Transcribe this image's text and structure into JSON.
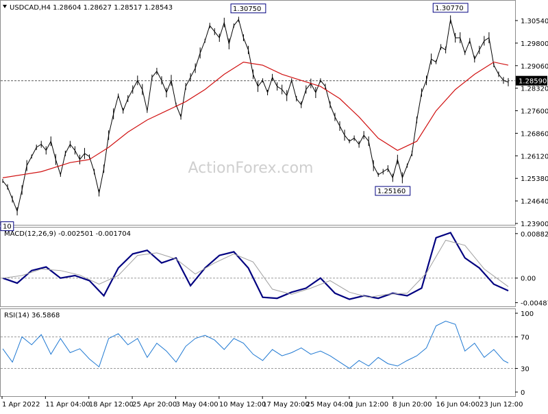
{
  "chart_data": {
    "type": "line",
    "symbol": "USDCAD",
    "timeframe": "H4",
    "title": "USDCAD,H4  1.28604  1.28627  1.28517  1.28543",
    "watermark": "ActionForex.com",
    "colors": {
      "price": "#000000",
      "ma": "#d01010",
      "macd": "#000080",
      "signal": "#a0a0a0",
      "rsi": "#1e78d2",
      "grid": "#9a9a9a",
      "tag_border": "#000080",
      "current_tag_bg": "#000000"
    },
    "panels": [
      {
        "name": "price",
        "ylim": [
          1.239,
          1.3097
        ],
        "yticks": [
          "1.30540",
          "1.29800",
          "1.29060",
          "1.28320",
          "1.27600",
          "1.26860",
          "1.26120",
          "1.25380",
          "1.24640",
          "1.23900"
        ],
        "current_price": "1.28590",
        "current_value": 1.2859,
        "labels": [
          {
            "text": "1.30750",
            "x": 51,
            "y": 1.3075
          },
          {
            "text": "1.30770",
            "x": 93,
            "y": 1.3077
          },
          {
            "text": "1.25160",
            "x": 81,
            "y": 1.2516
          },
          {
            "text": "10",
            "x": 0,
            "y": 1.24
          }
        ],
        "series": [
          {
            "role": "price",
            "x": [
              0,
              1,
              2,
              3,
              4,
              5,
              6,
              7,
              8,
              9,
              10,
              11,
              12,
              13,
              14,
              15,
              16,
              17,
              18,
              19,
              20,
              21,
              22,
              23,
              24,
              25,
              26,
              27,
              28,
              29,
              30,
              31,
              32,
              33,
              34,
              35,
              36,
              37,
              38,
              39,
              40,
              41,
              42,
              43,
              44,
              45,
              46,
              47,
              48,
              49,
              50,
              51,
              52,
              53,
              54,
              55,
              56,
              57,
              58,
              59,
              60,
              61,
              62,
              63,
              64,
              65,
              66,
              67,
              68,
              69,
              70,
              71,
              72,
              73,
              74,
              75,
              76,
              77,
              78,
              79,
              80,
              81,
              82,
              83,
              84,
              85,
              86,
              87,
              88,
              89,
              90,
              91,
              92,
              93,
              94,
              95,
              96,
              97,
              98,
              99,
              100,
              101,
              102,
              103,
              104,
              105
            ],
            "values": [
              1.253,
              1.251,
              1.247,
              1.243,
              1.25,
              1.258,
              1.261,
              1.264,
              1.265,
              1.263,
              1.266,
              1.26,
              1.255,
              1.262,
              1.265,
              1.263,
              1.26,
              1.262,
              1.261,
              1.256,
              1.249,
              1.257,
              1.268,
              1.275,
              1.281,
              1.276,
              1.28,
              1.283,
              1.286,
              1.283,
              1.276,
              1.287,
              1.289,
              1.286,
              1.282,
              1.286,
              1.278,
              1.274,
              1.284,
              1.287,
              1.29,
              1.295,
              1.299,
              1.304,
              1.302,
              1.3,
              1.305,
              1.298,
              1.304,
              1.306,
              1.3,
              1.296,
              1.288,
              1.284,
              1.286,
              1.282,
              1.287,
              1.284,
              1.283,
              1.281,
              1.286,
              1.28,
              1.278,
              1.283,
              1.285,
              1.282,
              1.286,
              1.284,
              1.278,
              1.274,
              1.271,
              1.268,
              1.266,
              1.267,
              1.265,
              1.268,
              1.266,
              1.258,
              1.255,
              1.256,
              1.257,
              1.254,
              1.26,
              1.254,
              1.258,
              1.262,
              1.273,
              1.282,
              1.286,
              1.293,
              1.292,
              1.297,
              1.296,
              1.306,
              1.3,
              1.3,
              1.295,
              1.299,
              1.293,
              1.296,
              1.299,
              1.3,
              1.291,
              1.288,
              1.286,
              1.2854
            ]
          },
          {
            "role": "moving-average",
            "x": [
              0,
              8,
              14,
              18,
              22,
              26,
              30,
              34,
              38,
              42,
              46,
              50,
              54,
              58,
              62,
              66,
              70,
              74,
              78,
              82,
              86,
              90,
              94,
              98,
              102,
              105
            ],
            "values": [
              1.254,
              1.256,
              1.259,
              1.26,
              1.264,
              1.269,
              1.273,
              1.276,
              1.279,
              1.283,
              1.288,
              1.292,
              1.291,
              1.288,
              1.286,
              1.284,
              1.28,
              1.274,
              1.267,
              1.263,
              1.266,
              1.276,
              1.283,
              1.288,
              1.292,
              1.291
            ]
          }
        ]
      },
      {
        "name": "macd",
        "title": "MACD(12,26,9) -0.002501 -0.001704",
        "ylim": [
          -0.0052,
          0.0092
        ],
        "yticks": [
          "0.00882",
          "0.00",
          "-0.004872"
        ],
        "zero_label": "0.00",
        "series": [
          {
            "role": "macd",
            "x": [
              0,
              3,
              6,
              9,
              12,
              15,
              18,
              21,
              24,
              27,
              30,
              33,
              36,
              39,
              42,
              45,
              48,
              51,
              54,
              57,
              60,
              63,
              66,
              69,
              72,
              75,
              78,
              81,
              84,
              87,
              90,
              93,
              96,
              99,
              102,
              105
            ],
            "values": [
              0.0,
              -0.001,
              0.0015,
              0.0022,
              0.0,
              0.0005,
              -0.0005,
              -0.0035,
              0.002,
              0.0048,
              0.0055,
              0.003,
              0.004,
              -0.0015,
              0.002,
              0.0045,
              0.0052,
              0.002,
              -0.0038,
              -0.004,
              -0.0028,
              -0.002,
              0.0,
              -0.003,
              -0.0042,
              -0.0035,
              -0.004,
              -0.003,
              -0.0035,
              -0.002,
              0.008,
              0.009,
              0.004,
              0.002,
              -0.0012,
              -0.0025
            ]
          },
          {
            "role": "signal",
            "x": [
              0,
              4,
              8,
              12,
              16,
              20,
              24,
              28,
              32,
              36,
              40,
              44,
              48,
              52,
              56,
              60,
              64,
              68,
              72,
              76,
              80,
              84,
              88,
              92,
              96,
              100,
              105
            ],
            "values": [
              0.0,
              0.0005,
              0.0018,
              0.0015,
              0.0006,
              -0.0012,
              0.0005,
              0.0045,
              0.005,
              0.0038,
              0.0008,
              0.003,
              0.0048,
              0.0032,
              -0.0022,
              -0.0032,
              -0.002,
              -0.0005,
              -0.0028,
              -0.0038,
              -0.0032,
              -0.003,
              0.001,
              0.0075,
              0.0065,
              0.0018,
              -0.0017
            ]
          }
        ]
      },
      {
        "name": "rsi",
        "title": "RSI(14) 36.5868",
        "ylim": [
          0,
          100
        ],
        "yticks": [
          "100",
          "70",
          "30",
          "0"
        ],
        "levels": [
          70,
          30
        ],
        "series": [
          {
            "role": "rsi",
            "x": [
              0,
              2,
              4,
              6,
              8,
              10,
              12,
              14,
              16,
              18,
              20,
              22,
              24,
              26,
              28,
              30,
              32,
              34,
              36,
              38,
              40,
              42,
              44,
              46,
              48,
              50,
              52,
              54,
              56,
              58,
              60,
              62,
              64,
              66,
              68,
              70,
              72,
              74,
              76,
              78,
              80,
              82,
              84,
              86,
              88,
              90,
              92,
              94,
              96,
              98,
              100,
              102,
              104,
              105
            ],
            "values": [
              55,
              38,
              70,
              60,
              73,
              48,
              68,
              50,
              55,
              42,
              32,
              68,
              74,
              60,
              68,
              44,
              62,
              52,
              38,
              58,
              68,
              72,
              66,
              54,
              68,
              62,
              48,
              40,
              54,
              46,
              50,
              56,
              48,
              52,
              46,
              38,
              30,
              40,
              33,
              44,
              36,
              33,
              40,
              46,
              56,
              84,
              90,
              86,
              52,
              62,
              44,
              54,
              40,
              37
            ]
          }
        ]
      }
    ],
    "x_labels": [
      "1 Apr 2022",
      "11 Apr 04:00",
      "18 Apr 12:00",
      "25 Apr 20:00",
      "3 May 04:00",
      "10 May 12:00",
      "17 May 20:00",
      "25 May 04:00",
      "1 Jun 12:00",
      "8 Jun 20:00",
      "16 Jun 04:00",
      "23 Jun 12:00"
    ]
  }
}
